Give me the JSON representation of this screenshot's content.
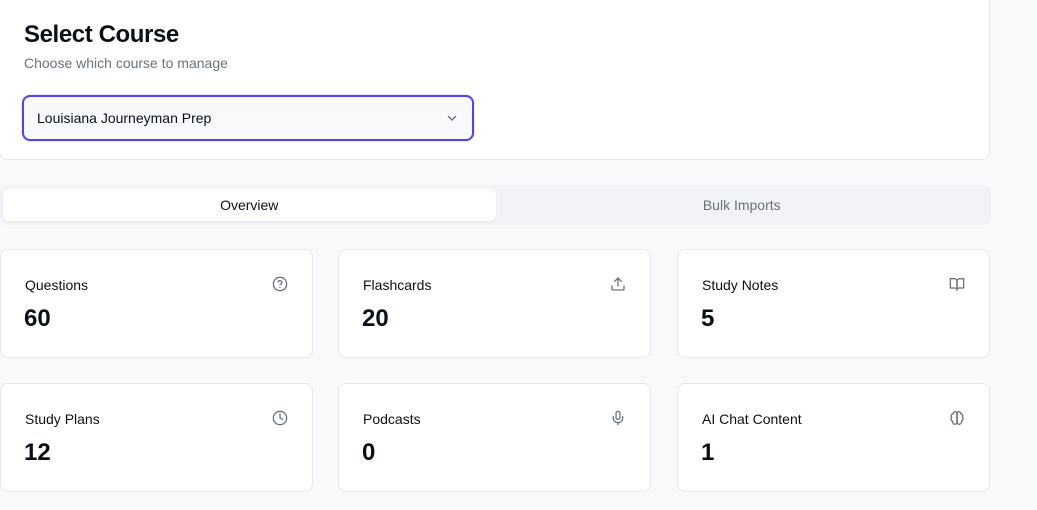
{
  "course_selector": {
    "title": "Select Course",
    "subtitle": "Choose which course to manage",
    "selected_course": "Louisiana Journeyman Prep"
  },
  "tabs": [
    {
      "label": "Overview",
      "active": true
    },
    {
      "label": "Bulk Imports",
      "active": false
    }
  ],
  "stats": [
    {
      "label": "Questions",
      "value": "60",
      "icon": "help-circle-icon"
    },
    {
      "label": "Flashcards",
      "value": "20",
      "icon": "upload-icon"
    },
    {
      "label": "Study Notes",
      "value": "5",
      "icon": "book-open-icon"
    },
    {
      "label": "Study Plans",
      "value": "12",
      "icon": "clock-icon"
    },
    {
      "label": "Podcasts",
      "value": "0",
      "icon": "microphone-icon"
    },
    {
      "label": "AI Chat Content",
      "value": "1",
      "icon": "brain-icon"
    }
  ],
  "colors": {
    "accent": "#4f46e5",
    "text": "#0b0f1a",
    "muted": "#6b7280",
    "border": "#e5e7eb"
  }
}
